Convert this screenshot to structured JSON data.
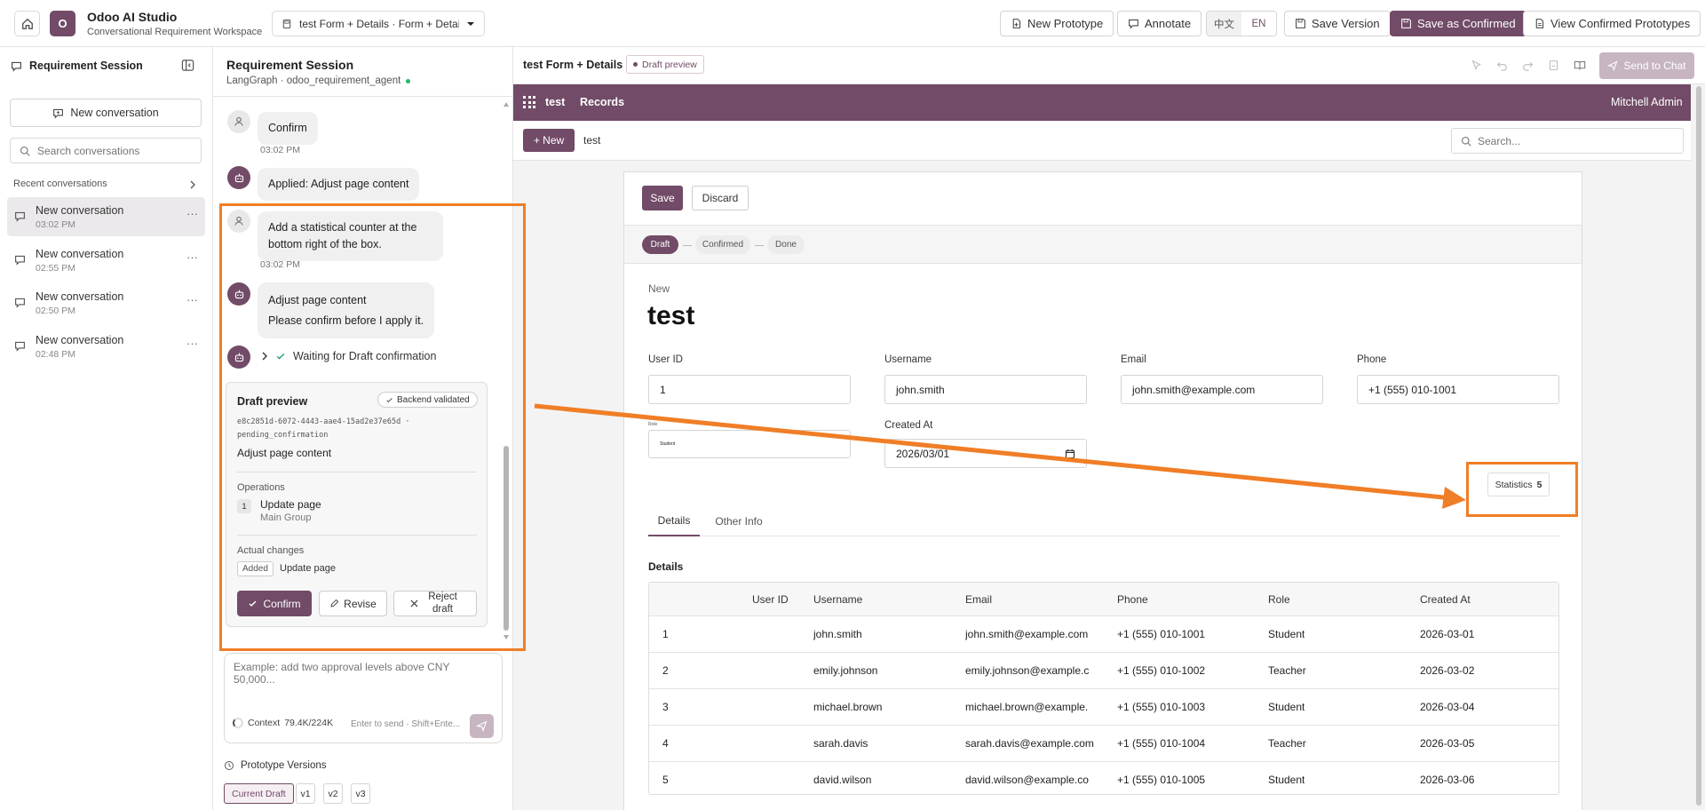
{
  "app": {
    "name": "Odoo AI Studio",
    "subtitle": "Conversational Requirement Workspace",
    "logo_letter": "O",
    "tab_title": "test Form + Details · Form + Details"
  },
  "toolbar": {
    "new_prototype": "New Prototype",
    "annotate": "Annotate",
    "lang_zh": "中文",
    "lang_en": "EN",
    "save_version": "Save Version",
    "save_confirmed": "Save as Confirmed",
    "view_confirmed": "View Confirmed Prototypes"
  },
  "sidebar": {
    "title": "Requirement Session",
    "new_conversation": "New conversation",
    "search_placeholder": "Search conversations",
    "recent_label": "Recent conversations",
    "items": [
      {
        "title": "New conversation",
        "time": "03:02 PM"
      },
      {
        "title": "New conversation",
        "time": "02:55 PM"
      },
      {
        "title": "New conversation",
        "time": "02:50 PM"
      },
      {
        "title": "New conversation",
        "time": "02:48 PM"
      }
    ]
  },
  "chat": {
    "title": "Requirement Session",
    "subtitle": "LangGraph · odoo_requirement_agent",
    "msg1": "Confirm",
    "time1": "03:02 PM",
    "msg2": "Applied: Adjust page content",
    "msg3": "Add a statistical counter at the bottom right of the box.",
    "time3": "03:02 PM",
    "msg4_line1": "Adjust page content",
    "msg4_line2": "Please confirm before I apply it.",
    "waiting": "Waiting for Draft confirmation",
    "draft": {
      "title": "Draft preview",
      "badge": "Backend validated",
      "id": "e8c2851d-6072-4443-aae4-15ad2e37e65d · pending_confirmation",
      "summary": "Adjust page content",
      "ops_label": "Operations",
      "op_num": "1",
      "op_title": "Update page",
      "op_sub": "Main Group",
      "changes_label": "Actual changes",
      "change_tag": "Added",
      "change_text": "Update page",
      "confirm": "Confirm",
      "revise": "Revise",
      "reject": "Reject draft"
    },
    "input_placeholder": "Example: add two approval levels above CNY 50,000...",
    "context_label": "Context",
    "context_value": "79.4K/224K",
    "send_hint": "Enter to send · Shift+Ente...",
    "versions_label": "Prototype Versions",
    "versions": [
      "Current Draft",
      "v1",
      "v2",
      "v3"
    ]
  },
  "preview": {
    "title": "test Form + Details",
    "badge": "Draft preview",
    "send_to_chat": "Send to Chat"
  },
  "odoo": {
    "app_name": "test",
    "menu": "Records",
    "user": "Mitchell Admin",
    "new_btn": "+ New",
    "breadcrumb": "test",
    "search_placeholder": "Search...",
    "save": "Save",
    "discard": "Discard",
    "stages": [
      "Draft",
      "Confirmed",
      "Done"
    ],
    "record_label": "New",
    "record_title": "test",
    "fields": {
      "user_id_label": "User ID",
      "user_id": "1",
      "username_label": "Username",
      "username": "john.smith",
      "email_label": "Email",
      "email": "john.smith@example.com",
      "phone_label": "Phone",
      "phone": "+1 (555) 010-1001",
      "role_label": "Role",
      "role": "Student",
      "created_label": "Created At",
      "created": "2026/03/01"
    },
    "stat_label": "Statistics",
    "stat_value": "5",
    "tabs": [
      "Details",
      "Other Info"
    ],
    "section_title": "Details",
    "columns": [
      "User ID",
      "Username",
      "Email",
      "Phone",
      "Role",
      "Created At"
    ],
    "rows": [
      [
        "1",
        "john.smith",
        "john.smith@example.com",
        "+1 (555) 010-1001",
        "Student",
        "2026-03-01"
      ],
      [
        "2",
        "emily.johnson",
        "emily.johnson@example.c",
        "+1 (555) 010-1002",
        "Teacher",
        "2026-03-02"
      ],
      [
        "3",
        "michael.brown",
        "michael.brown@example.",
        "+1 (555) 010-1003",
        "Student",
        "2026-03-04"
      ],
      [
        "4",
        "sarah.davis",
        "sarah.davis@example.com",
        "+1 (555) 010-1004",
        "Teacher",
        "2026-03-05"
      ],
      [
        "5",
        "david.wilson",
        "david.wilson@example.co",
        "+1 (555) 010-1005",
        "Student",
        "2026-03-06"
      ]
    ]
  },
  "colors": {
    "brand": "#714b67",
    "highlight": "#f07e26"
  }
}
